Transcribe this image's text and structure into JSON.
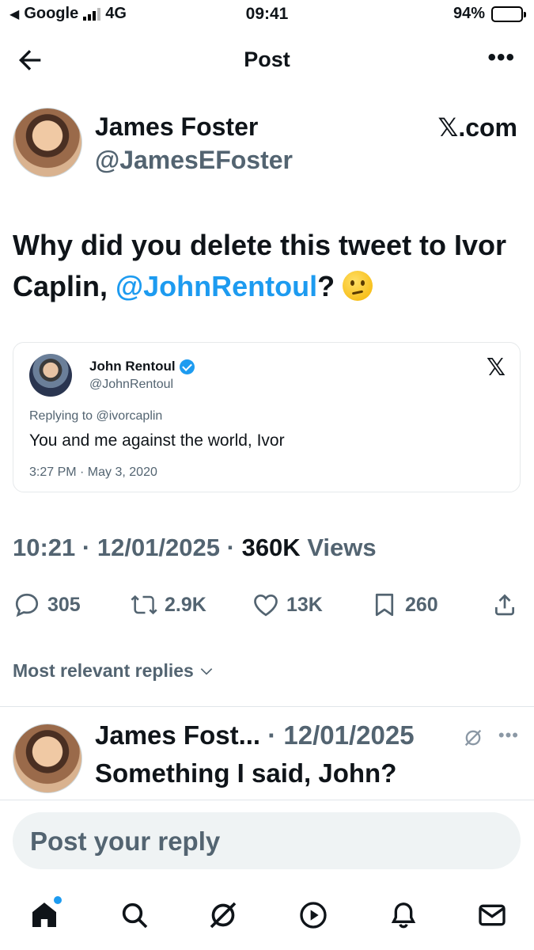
{
  "status_bar": {
    "carrier": "Google",
    "network": "4G",
    "time": "09:41",
    "battery": "94%",
    "battery_level": 0.94
  },
  "header": {
    "title": "Post"
  },
  "post": {
    "author_name": "James Foster",
    "author_handle": "@JamesEFoster",
    "source": "𝕏.com",
    "text_before": "Why did you delete this tweet to Ivor Caplin, ",
    "mention": "@JohnRentoul",
    "text_after": "? ",
    "emoji": "thinking-face",
    "time": "10:21",
    "date": "12/01/2025",
    "views_count": "360K",
    "views_label": "Views"
  },
  "quoted": {
    "name": "John Rentoul",
    "handle": "@JohnRentoul",
    "replying_to": "Replying to @ivorcaplin",
    "text": "You and me against the world, Ivor",
    "timestamp": "3:27 PM · May 3, 2020"
  },
  "actions": {
    "replies": "305",
    "reposts": "2.9K",
    "likes": "13K",
    "bookmarks": "260"
  },
  "replies_filter": "Most relevant replies",
  "reply": {
    "author_name": "James Fost...",
    "date": "12/01/2025",
    "text": "Something I said, John?"
  },
  "compose": {
    "placeholder": "Post your reply"
  },
  "colors": {
    "accent": "#1d9bf0",
    "secondary_text": "#536471",
    "primary_text": "#0f1419"
  }
}
